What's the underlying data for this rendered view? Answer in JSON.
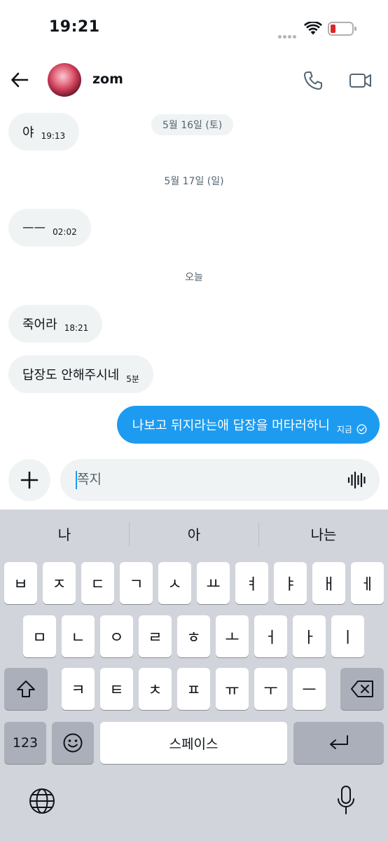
{
  "status_bar": {
    "time": "19:21"
  },
  "header": {
    "contact_name": "zom"
  },
  "messages": {
    "date_1": "5월 16일 (토)",
    "date_2": "5월 17일 (일)",
    "date_3": "오늘",
    "msg_1": {
      "text": "야",
      "time": "19:13"
    },
    "msg_2": {
      "text": "ㅡㅡ",
      "time": "02:02"
    },
    "msg_3": {
      "text": "죽어라",
      "time": "18:21"
    },
    "msg_4": {
      "text": "답장도 안해주시네",
      "time": "5분"
    },
    "msg_5": {
      "text": "나보고 뒤지라는애 답장을 머타러하니",
      "time": "지금"
    }
  },
  "composer": {
    "placeholder": "쪽지"
  },
  "keyboard": {
    "suggestions": [
      "나",
      "아",
      "나는"
    ],
    "row1": [
      "ㅂ",
      "ㅈ",
      "ㄷ",
      "ㄱ",
      "ㅅ",
      "ㅛ",
      "ㅕ",
      "ㅑ",
      "ㅐ",
      "ㅔ"
    ],
    "row2": [
      "ㅁ",
      "ㄴ",
      "ㅇ",
      "ㄹ",
      "ㅎ",
      "ㅗ",
      "ㅓ",
      "ㅏ",
      "ㅣ"
    ],
    "row3": [
      "ㅋ",
      "ㅌ",
      "ㅊ",
      "ㅍ",
      "ㅠ",
      "ㅜ",
      "ㅡ"
    ],
    "numbers_label": "123",
    "space_label": "스페이스"
  },
  "colors": {
    "accent": "#1d9bf0",
    "bubble_in": "#eff3f4",
    "keyboard_bg": "#d1d4db"
  },
  "icons": [
    "back-arrow-icon",
    "phone-icon",
    "video-camera-icon",
    "plus-icon",
    "waveform-icon",
    "shift-icon",
    "backspace-icon",
    "emoji-icon",
    "return-icon",
    "globe-icon",
    "microphone-icon",
    "wifi-icon",
    "battery-icon",
    "check-circle-icon"
  ]
}
